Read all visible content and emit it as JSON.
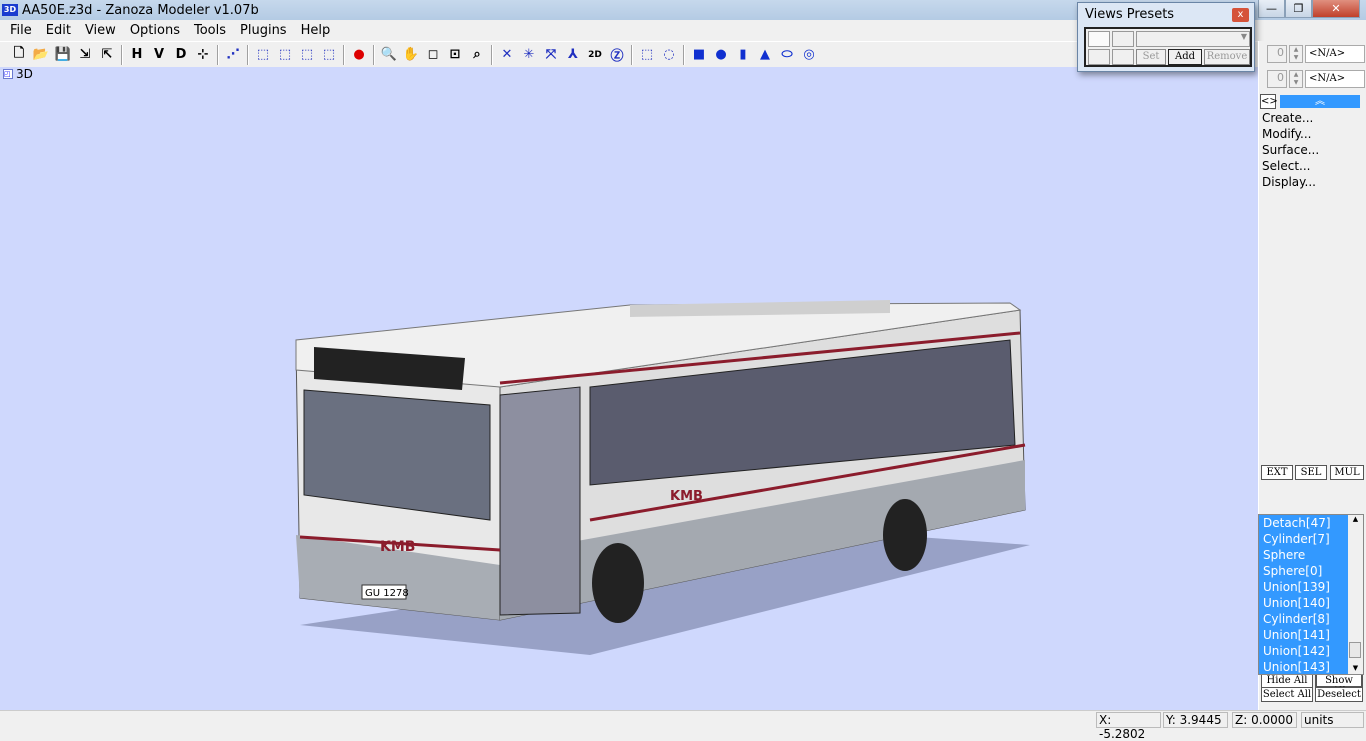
{
  "window": {
    "title": "AA50E.z3d - Zanoza Modeler v1.07b",
    "app_icon": "3D",
    "minimize": "—",
    "maximize": "❐",
    "close": "✕"
  },
  "menu": [
    "File",
    "Edit",
    "View",
    "Options",
    "Tools",
    "Plugins",
    "Help"
  ],
  "toolbar": [
    {
      "name": "new-file-icon",
      "glyph": "🗋"
    },
    {
      "name": "open-folder-icon",
      "glyph": "📂"
    },
    {
      "name": "save-icon",
      "glyph": "💾"
    },
    {
      "name": "import-icon",
      "glyph": "⇲"
    },
    {
      "name": "export-icon",
      "glyph": "⇱"
    },
    {
      "sep": true
    },
    {
      "name": "view-h-button",
      "glyph": "H"
    },
    {
      "name": "view-v-button",
      "glyph": "V"
    },
    {
      "name": "view-d-button",
      "glyph": "D"
    },
    {
      "name": "axes-icon",
      "glyph": "⊹"
    },
    {
      "sep": true
    },
    {
      "name": "vertex-select-icon",
      "glyph": "⋰"
    },
    {
      "sep": true
    },
    {
      "name": "cube-select-1-icon",
      "glyph": "⬚"
    },
    {
      "name": "cube-select-2-icon",
      "glyph": "⬚"
    },
    {
      "name": "cube-select-3-icon",
      "glyph": "⬚"
    },
    {
      "name": "cube-select-4-icon",
      "glyph": "⬚"
    },
    {
      "sep": true
    },
    {
      "name": "render-sphere-icon",
      "glyph": "●"
    },
    {
      "sep": true
    },
    {
      "name": "zoom-icon",
      "glyph": "🔍"
    },
    {
      "name": "pan-hand-icon",
      "glyph": "✋"
    },
    {
      "name": "box-icon",
      "glyph": "◻"
    },
    {
      "name": "fit-view-icon",
      "glyph": "⊡"
    },
    {
      "name": "camera-icon",
      "glyph": "⌕"
    },
    {
      "sep": true
    },
    {
      "name": "move-icon",
      "glyph": "✕"
    },
    {
      "name": "rotate-icon",
      "glyph": "✳"
    },
    {
      "name": "scale-icon",
      "glyph": "⤧"
    },
    {
      "name": "axis-tripod-icon",
      "glyph": "⅄"
    },
    {
      "name": "2d-3d-icon",
      "glyph": "2D"
    },
    {
      "name": "no-z-icon",
      "glyph": "Ⓩ"
    },
    {
      "sep": true
    },
    {
      "name": "rect-select-icon",
      "glyph": "⬚"
    },
    {
      "name": "circle-select-icon",
      "glyph": "◌"
    },
    {
      "sep": true
    },
    {
      "name": "create-cube-icon",
      "glyph": "■"
    },
    {
      "name": "create-sphere-icon",
      "glyph": "●"
    },
    {
      "name": "create-cylinder-icon",
      "glyph": "▮"
    },
    {
      "name": "create-cone-icon",
      "glyph": "▲"
    },
    {
      "name": "create-torus-icon",
      "glyph": "⬭"
    },
    {
      "name": "create-ring-icon",
      "glyph": "◎"
    }
  ],
  "viewport": {
    "label": "3D",
    "background": "#cfd8fd",
    "plate": "GU 1278",
    "logo": "KMB"
  },
  "presets": {
    "title": "Views Presets",
    "set": "Set",
    "add": "Add",
    "remove": "Remove",
    "close": "x"
  },
  "panel": {
    "spin1": "0",
    "na1": "<N/A>",
    "spin2": "0",
    "na2": "<N/A>",
    "toggle": "<>",
    "collapse": "︽",
    "commands": [
      "Create...",
      "Modify...",
      "Surface...",
      "Select...",
      "Display..."
    ],
    "ext": "EXT",
    "sel": "SEL",
    "mul": "MUL"
  },
  "objects": [
    "Detach[47]",
    "Cylinder[7]",
    "Sphere",
    "Sphere[0]",
    "Union[139]",
    "Union[140]",
    "Cylinder[8]",
    "Union[141]",
    "Union[142]",
    "Union[143]"
  ],
  "list_buttons": {
    "hide_all": "Hide All",
    "show_all": "Show All",
    "select_all": "Select All",
    "deselect": "Deselect"
  },
  "status": {
    "x": "X: -5.2802",
    "y": "Y: 3.9445",
    "z": "Z: 0.0000",
    "units": "units"
  }
}
